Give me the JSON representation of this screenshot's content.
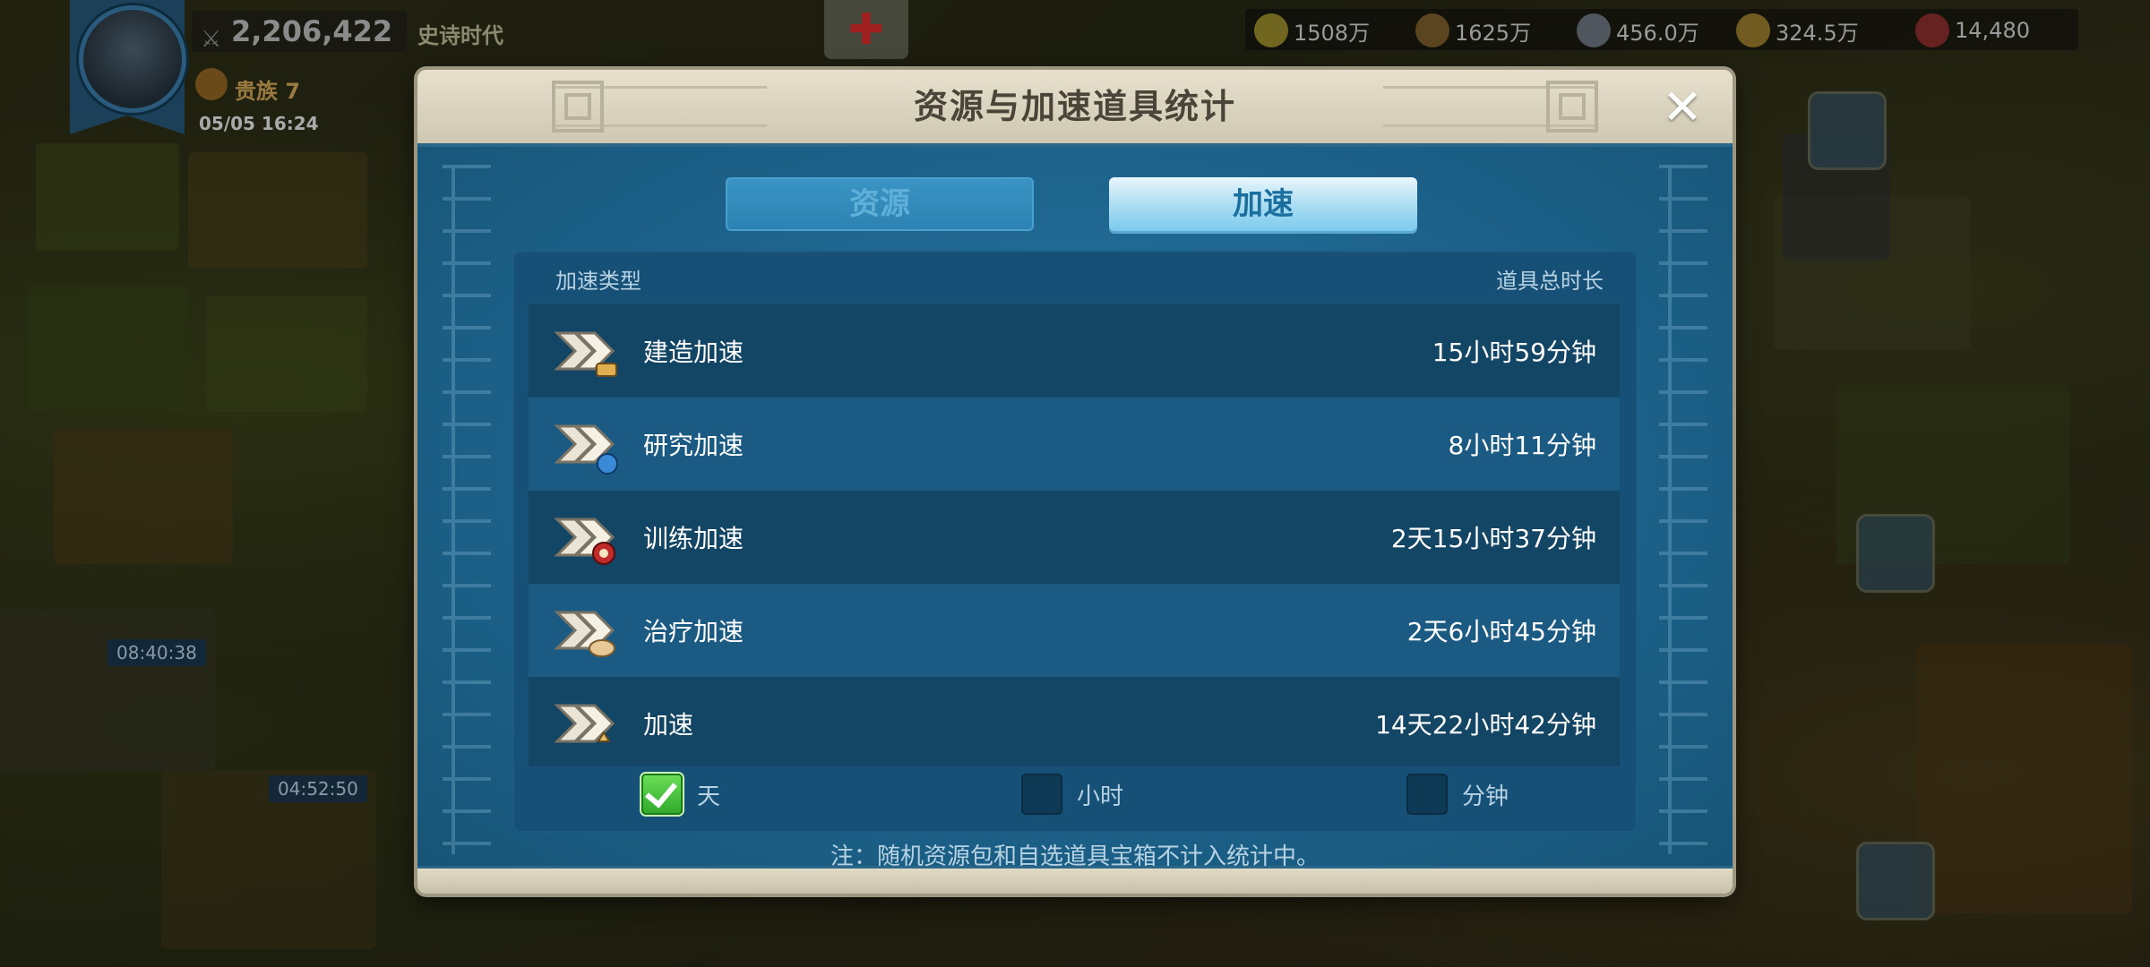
{
  "hud": {
    "power": "2,206,422",
    "era": "史诗时代",
    "vip": "贵族 7",
    "datetime": "05/05 16:24",
    "resources": [
      {
        "name": "food",
        "icon": "corn-icon",
        "value": "1508万",
        "color": "#d8c23a"
      },
      {
        "name": "wood",
        "icon": "wood-icon",
        "value": "1625万",
        "color": "#b07a3a"
      },
      {
        "name": "stone",
        "icon": "stone-icon",
        "value": "456.0万",
        "color": "#a8b4c0"
      },
      {
        "name": "gold",
        "icon": "gold-icon",
        "value": "324.5万",
        "color": "#e0b83a"
      },
      {
        "name": "gems",
        "icon": "gem-icon",
        "value": "14,480",
        "color": "#d8323a"
      }
    ],
    "timers": [
      "08:40:38",
      "04:52:50"
    ]
  },
  "modal": {
    "title": "资源与加速道具统计",
    "tabs": [
      {
        "label": "资源",
        "active": false
      },
      {
        "label": "加速",
        "active": true
      }
    ],
    "columns": {
      "type": "加速类型",
      "duration": "道具总时长"
    },
    "rows": [
      {
        "label": "建造加速",
        "value": "15小时59分钟",
        "icon": "build-speedup-icon",
        "accent": "#e0b050"
      },
      {
        "label": "研究加速",
        "value": "8小时11分钟",
        "icon": "research-speedup-icon",
        "accent": "#3a8ad8"
      },
      {
        "label": "训练加速",
        "value": "2天15小时37分钟",
        "icon": "training-speedup-icon",
        "accent": "#c02a2a"
      },
      {
        "label": "治疗加速",
        "value": "2天6小时45分钟",
        "icon": "healing-speedup-icon",
        "accent": "#e8c896"
      },
      {
        "label": "加速",
        "value": "14天22小时42分钟",
        "icon": "universal-speedup-icon",
        "accent": "#e0c070"
      }
    ],
    "units": [
      {
        "label": "天",
        "checked": true
      },
      {
        "label": "小时",
        "checked": false
      },
      {
        "label": "分钟",
        "checked": false
      }
    ],
    "note": "注：随机资源包和自选道具宝箱不计入统计中。"
  }
}
